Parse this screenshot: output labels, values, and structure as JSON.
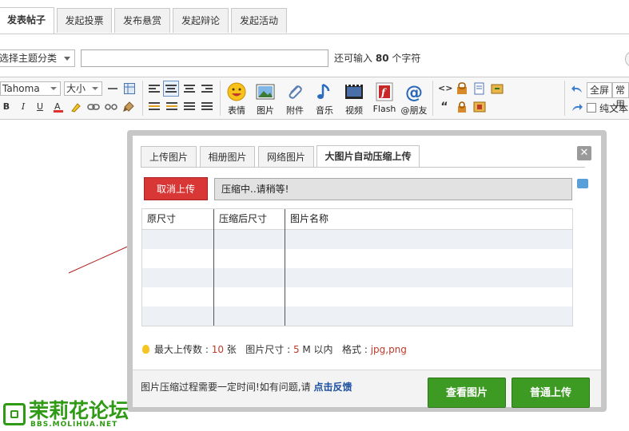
{
  "tabs": [
    {
      "label": "发表帖子",
      "active": true
    },
    {
      "label": "发起投票",
      "active": false
    },
    {
      "label": "发布悬赏",
      "active": false
    },
    {
      "label": "发起辩论",
      "active": false
    },
    {
      "label": "发起活动",
      "active": false
    }
  ],
  "subject": {
    "category_value": "选择主题分类",
    "title_value": "",
    "remain_prefix": "还可输入",
    "remain_count": "80",
    "remain_suffix": "个字符"
  },
  "toolbar": {
    "font_family": "Tahoma",
    "font_size": "大小",
    "media": [
      {
        "label": "表情",
        "icon": "smiley-icon"
      },
      {
        "label": "图片",
        "icon": "image-icon"
      },
      {
        "label": "附件",
        "icon": "paperclip-icon"
      },
      {
        "label": "音乐",
        "icon": "music-note-icon"
      },
      {
        "label": "视频",
        "icon": "film-icon"
      },
      {
        "label": "Flash",
        "icon": "flash-icon"
      },
      {
        "label": "@朋友",
        "icon": "at-sign-icon"
      }
    ],
    "fullscreen_label": "全屏",
    "common_label": "常用",
    "plaintext_label": "纯文本"
  },
  "dialog": {
    "tabs": [
      {
        "label": "上传图片",
        "active": false
      },
      {
        "label": "相册图片",
        "active": false
      },
      {
        "label": "网络图片",
        "active": false
      },
      {
        "label": "大图片自动压缩上传",
        "active": true
      }
    ],
    "close_symbol": "✕",
    "cancel_label": "取消上传",
    "progress_text": "压缩中..请稍等!",
    "columns": [
      "原尺寸",
      "压缩后尺寸",
      "图片名称"
    ],
    "limits": {
      "max_label": "最大上传数 : ",
      "max_value": "10",
      "max_unit": " 张",
      "size_label": "图片尺寸 : ",
      "size_value": "5",
      "size_unit": " M 以内",
      "format_label": "格式 : ",
      "format_value": "jpg,png"
    },
    "footer_note": "图片压缩过程需要一定时间!如有问题,请",
    "feedback_link": "点击反馈",
    "view_label": "查看图片",
    "normal_upload_label": "普通上传"
  },
  "logo": {
    "name": "茉莉花论坛",
    "url": "BBS.MOLIHUA.NET"
  },
  "colors": {
    "accent_green": "#3d9a22",
    "cancel_red": "#d93636",
    "limit_red": "#c0392b",
    "annotation_arrow": "#b21e1e"
  }
}
